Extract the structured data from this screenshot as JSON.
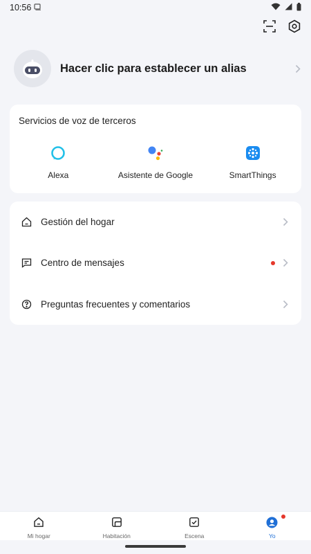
{
  "status_bar": {
    "time": "10:56"
  },
  "profile": {
    "name": "Hacer clic para establecer un alias"
  },
  "voice_services": {
    "title": "Servicios de voz de terceros",
    "items": [
      {
        "label": "Alexa",
        "icon": "alexa-icon"
      },
      {
        "label": "Asistente de Google",
        "icon": "google-assistant-icon"
      },
      {
        "label": "SmartThings",
        "icon": "smartthings-icon"
      }
    ]
  },
  "menu": {
    "items": [
      {
        "label": "Gestión del hogar",
        "icon": "home-icon"
      },
      {
        "label": "Centro de mensajes",
        "icon": "message-icon",
        "badge": true
      },
      {
        "label": "Preguntas frecuentes y comentarios",
        "icon": "help-icon"
      }
    ]
  },
  "bottom_nav": {
    "items": [
      {
        "label": "Mi hogar",
        "icon": "home-icon"
      },
      {
        "label": "Habitación",
        "icon": "room-icon"
      },
      {
        "label": "Escena",
        "icon": "scene-icon"
      },
      {
        "label": "Yo",
        "icon": "profile-icon",
        "active": true
      }
    ]
  },
  "colors": {
    "background": "#f4f5f9",
    "accent": "#1f6fd6",
    "badge": "#e5372b",
    "alexa": "#22c0e8",
    "smartthings": "#1a8cf0"
  }
}
